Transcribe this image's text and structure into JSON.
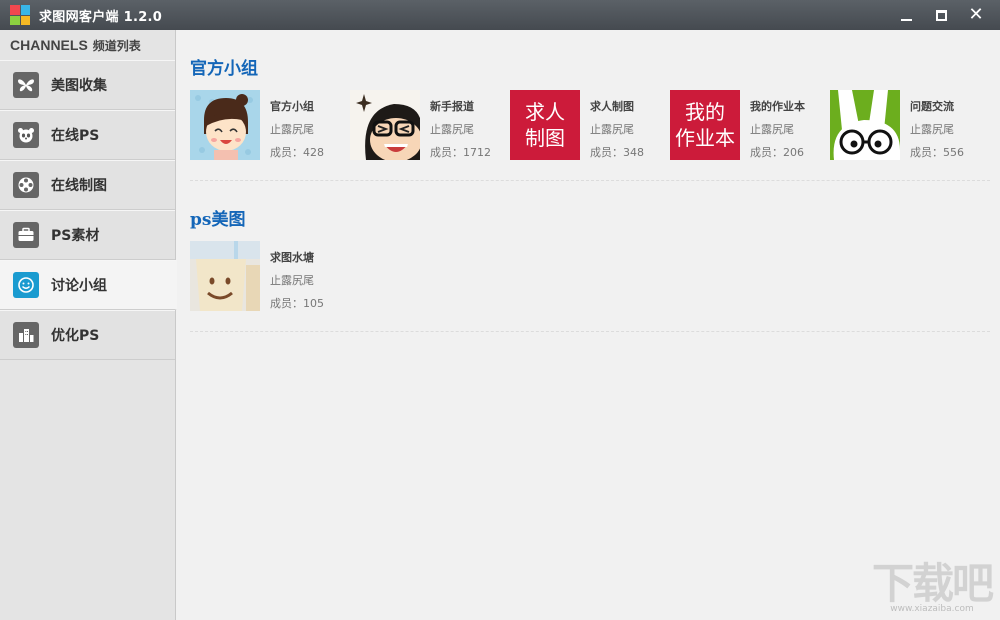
{
  "window": {
    "title": "求图网客户端 1.2.0"
  },
  "sidebar": {
    "header_en": "CHANNELS",
    "header_cn": "频道列表",
    "items": [
      {
        "label": "美图收集",
        "icon": "butterfly-icon"
      },
      {
        "label": "在线PS",
        "icon": "panda-icon"
      },
      {
        "label": "在线制图",
        "icon": "film-reel-icon"
      },
      {
        "label": "PS素材",
        "icon": "briefcase-icon"
      },
      {
        "label": "讨论小组",
        "icon": "smiley-icon",
        "active": true
      },
      {
        "label": "优化PS",
        "icon": "buildings-icon"
      }
    ]
  },
  "sections": [
    {
      "title": "官方小组",
      "groups": [
        {
          "name": "官方小组",
          "owner": "止露尻尾",
          "members": "成员：428"
        },
        {
          "name": "新手报道",
          "owner": "止露尻尾",
          "members": "成员：1712"
        },
        {
          "name": "求人制图",
          "owner": "止露尻尾",
          "members": "成员：348",
          "thumb_text": [
            "求人",
            "制图"
          ]
        },
        {
          "name": "我的作业本",
          "owner": "止露尻尾",
          "members": "成员：206",
          "thumb_text": [
            "我的",
            "作业本"
          ]
        },
        {
          "name": "问题交流",
          "owner": "止露尻尾",
          "members": "成员：556"
        }
      ]
    },
    {
      "title": "ps美图",
      "groups": [
        {
          "name": "求图水塘",
          "owner": "止露尻尾",
          "members": "成员：105"
        }
      ]
    }
  ],
  "watermark": {
    "big": "下载吧",
    "small": "www.xiazaiba.com"
  },
  "colors": {
    "accent": "#1466b8",
    "active_icon": "#1a9bd0",
    "thumb_red": "#cc1b3a",
    "titlebar": "#4f555b"
  }
}
